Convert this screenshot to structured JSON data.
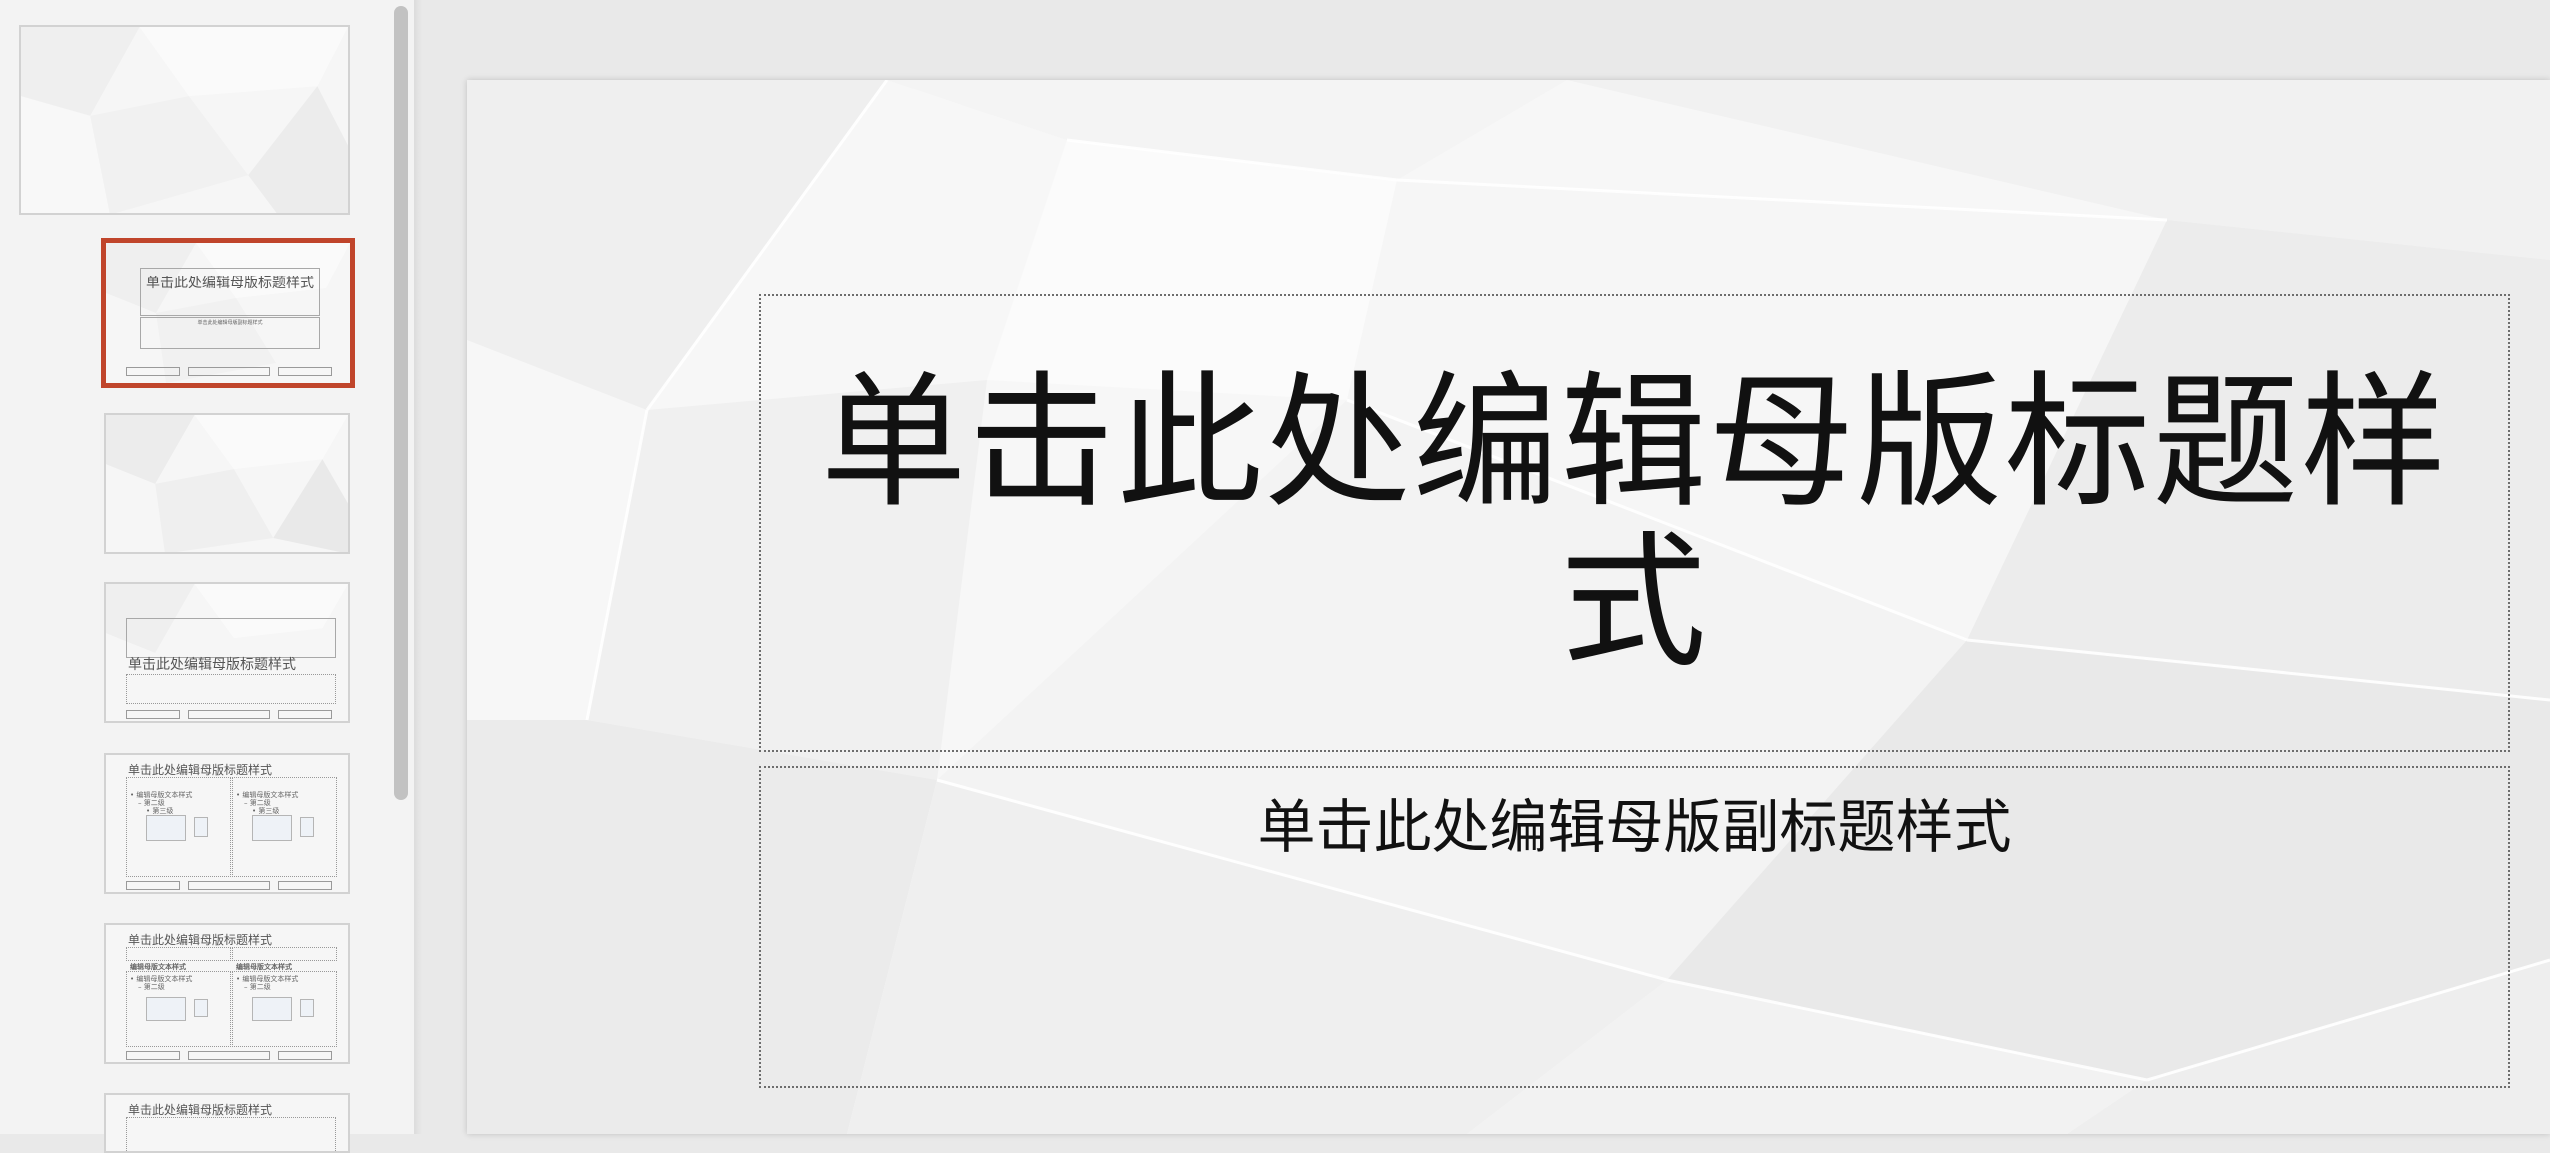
{
  "slide": {
    "title_placeholder": "单击此处编辑母版标题样式",
    "subtitle_placeholder": "单击此处编辑母版副标题样式"
  },
  "thumbnails": {
    "layout1": {
      "title": "单击此处编辑母版标题样式",
      "subtitle": "单击此处编辑母版副标题样式"
    },
    "layout3": {
      "title": "单击此处编辑母版标题样式"
    },
    "layout4": {
      "title": "单击此处编辑母版标题样式",
      "col_heading": "• 编辑母版文本样式",
      "level2": "– 第二级",
      "level3": "• 第三级"
    },
    "layout5": {
      "title": "单击此处编辑母版标题样式",
      "col_label": "编辑母版文本样式",
      "col_heading": "• 编辑母版文本样式",
      "level2": "– 第二级"
    },
    "layout6": {
      "title": "单击此处编辑母版标题样式"
    }
  },
  "colors": {
    "selection_border": "#c0452b",
    "canvas_bg": "#e9e9e9",
    "slide_bg": "#f7f7f7"
  }
}
